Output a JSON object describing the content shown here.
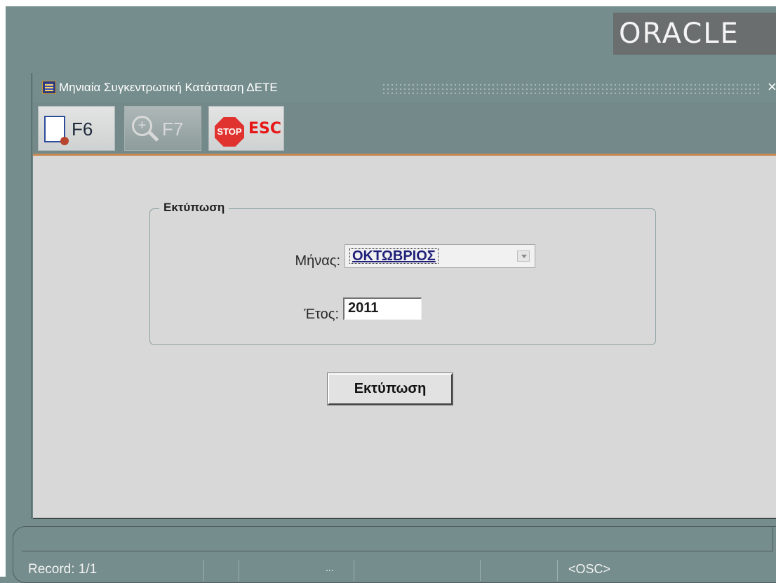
{
  "brand": {
    "logo_text": "ORACLE"
  },
  "window": {
    "title": "Μηνιαία Συγκεντρωτική Κατάσταση ΔΕΤΕ",
    "close_label": "×"
  },
  "toolbar": {
    "buttons": [
      {
        "label": "F6",
        "icon": "new-document-icon",
        "enabled": true
      },
      {
        "label": "F7",
        "icon": "zoom-icon",
        "enabled": false
      },
      {
        "label": "ESC",
        "icon": "stop-icon",
        "icon_text": "STOP",
        "enabled": true
      }
    ]
  },
  "print_group": {
    "title": "Εκτύπωση",
    "month_label": "Μήνας:",
    "month_value": "ΟΚΤΩΒΡΙΟΣ",
    "year_label": "Έτος:",
    "year_value": "2011"
  },
  "actions": {
    "print_label": "Εκτύπωση"
  },
  "statusbar": {
    "record": "Record: 1/1",
    "ellipsis": "...",
    "mode": "<OSC>"
  },
  "colors": {
    "desktop": "#768d8d",
    "canvas": "#d8d8d8",
    "toolbar_accent": "#c98a52",
    "stop_red": "#e0322e",
    "oracle_logo_bg": "#6a6e6f"
  }
}
